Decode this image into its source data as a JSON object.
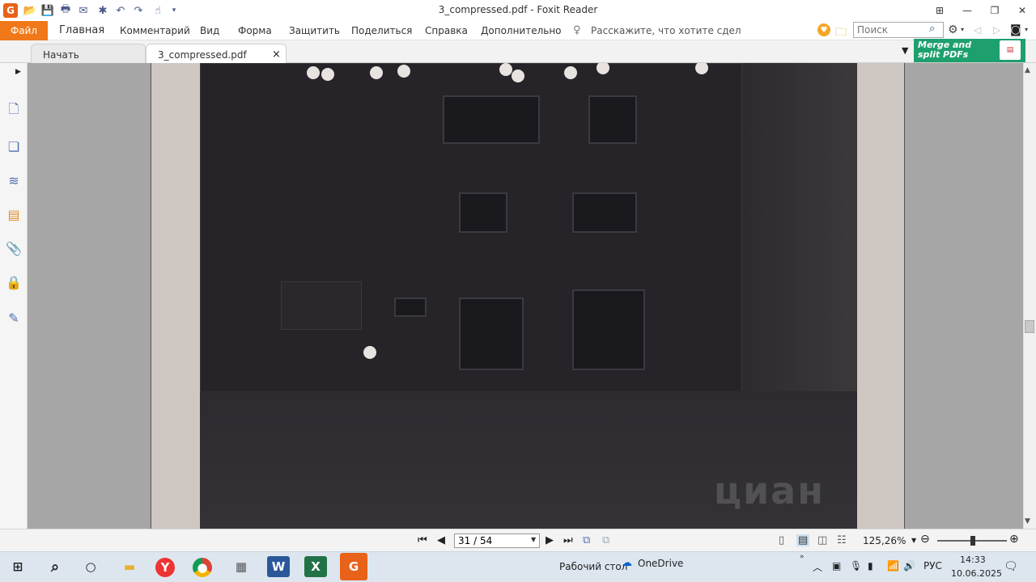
{
  "window": {
    "title": "3_compressed.pdf - Foxit Reader",
    "logo_letter": "G"
  },
  "ribbon": {
    "file": "Файл",
    "tabs": [
      "Главная",
      "Комментарий",
      "Вид",
      "Форма",
      "Защитить",
      "Поделиться",
      "Справка",
      "Дополнительно"
    ],
    "tell_me": "Расскажите, что хотите сдел",
    "search_placeholder": "Поиск"
  },
  "doc_tabs": {
    "start": "Начать",
    "document": "3_compressed.pdf",
    "close": "×"
  },
  "banner": {
    "line1": "Merge and",
    "line2": "split PDFs"
  },
  "document": {
    "watermark": "циан"
  },
  "statusbar": {
    "page_value": "31 / 54",
    "zoom": "125,26%"
  },
  "taskbar": {
    "desktop": "Рабочий стол",
    "onedrive": "OneDrive",
    "language": "РУС",
    "time": "14:33",
    "date": "10.06.2025"
  },
  "colors": {
    "file_tab": "#f07818",
    "banner": "#1ea06e",
    "doc_background": "#a6a6a6"
  }
}
